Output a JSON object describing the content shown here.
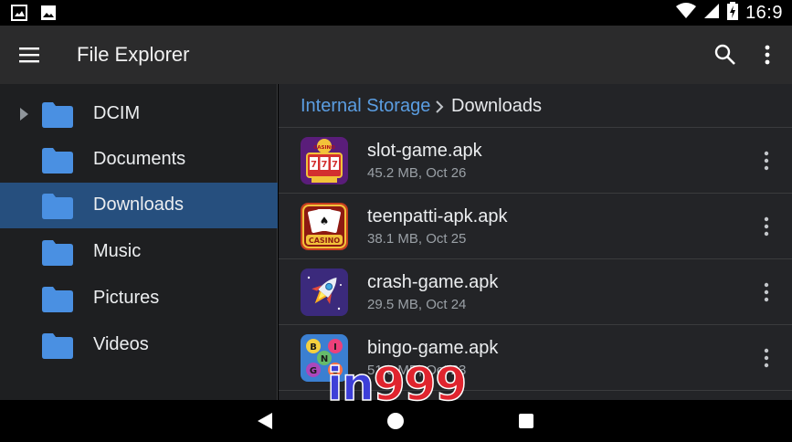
{
  "status_bar": {
    "time": "16:9",
    "icons": [
      "image-notification-icon",
      "photo-notification-icon",
      "wifi-icon",
      "signal-icon",
      "battery-charging-icon"
    ]
  },
  "app_bar": {
    "title": "File Explorer",
    "icons": [
      "menu-icon",
      "search-icon",
      "more-vert-icon"
    ]
  },
  "sidebar": {
    "items": [
      {
        "label": "DCIM",
        "expandable": true,
        "active": false
      },
      {
        "label": "Documents",
        "expandable": false,
        "active": false
      },
      {
        "label": "Downloads",
        "expandable": false,
        "active": true
      },
      {
        "label": "Music",
        "expandable": false,
        "active": false
      },
      {
        "label": "Pictures",
        "expandable": false,
        "active": false
      },
      {
        "label": "Videos",
        "expandable": false,
        "active": false
      }
    ]
  },
  "breadcrumb": {
    "root": "Internal Storage",
    "current": "Downloads"
  },
  "files": [
    {
      "name": "slot-game.apk",
      "meta": "45.2 MB, Oct 26",
      "icon": "slot-machine-icon",
      "icon_text": "CASINO"
    },
    {
      "name": "teenpatti-apk.apk",
      "meta": "38.1 MB, Oct 25",
      "icon": "playing-cards-icon",
      "icon_text": "CASINO"
    },
    {
      "name": "crash-game.apk",
      "meta": "29.5 MB, Oct 24",
      "icon": "rocket-icon"
    },
    {
      "name": "bingo-game.apk",
      "meta": "51.0 MB, Oct 23",
      "icon": "bingo-balls-icon",
      "icon_letters": [
        "B",
        "I",
        "N",
        "G",
        "O"
      ]
    }
  ],
  "nav_bar": {
    "icons": [
      "back-icon",
      "home-icon",
      "recents-icon"
    ]
  },
  "watermark": {
    "part1": "in",
    "part2": "999"
  },
  "colors": {
    "accent": "#5b9ee2",
    "active_row": "#264f7e",
    "folder": "#4a90e2",
    "app_bar": "#2b2b2c"
  }
}
